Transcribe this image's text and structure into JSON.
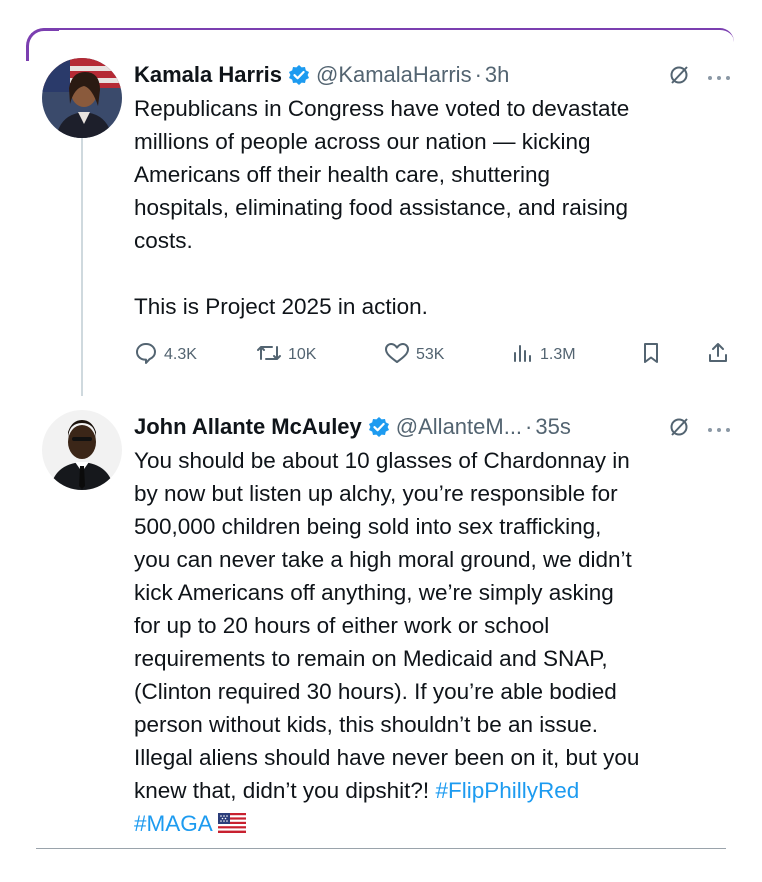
{
  "tweet1": {
    "name": "Kamala Harris",
    "handle": "@KamalaHarris",
    "dot": "·",
    "time": "3h",
    "lines": [
      "Republicans in Congress have voted to devastate",
      "millions of people across our nation — kicking",
      "Americans off their health care, shuttering",
      "hospitals, eliminating food assistance, and raising",
      "costs."
    ],
    "line2": "This is Project 2025 in action.",
    "actions": {
      "replies": "4.3K",
      "reposts": "10K",
      "likes": "53K",
      "views": "1.3M"
    },
    "icons": {
      "reply": "reply-icon",
      "repost": "repost-icon",
      "like": "like-icon",
      "views": "views-icon",
      "bookmark": "bookmark-icon",
      "share": "share-icon"
    }
  },
  "tweet2": {
    "name": "John Allante McAuley",
    "handle": "@AllanteM...",
    "dot": "·",
    "time": "35s",
    "lines": [
      "You should be about 10 glasses of Chardonnay in",
      "by now but listen up alchy, you’re responsible for",
      "500,000 children being sold into sex trafficking,",
      "you can never take a high moral ground, we didn’t",
      "kick Americans off anything, we’re simply asking",
      "for up to 20 hours of either work or school",
      "requirements to remain on Medicaid and SNAP,",
      "(Clinton required 30 hours). If you’re able bodied",
      "person without kids, this shouldn’t be an issue.",
      "Illegal aliens should have never been on it, but you"
    ],
    "last_line_text": "knew that, didn’t you dipshit?! ",
    "hashtag1": "#FlipPhillyRed",
    "hashtag2": "#MAGA",
    "flag_emoji": "us-flag-icon"
  },
  "colors": {
    "accent": "#1d9bf0",
    "muted": "#536471",
    "border_purple": "#7b3fb0"
  }
}
